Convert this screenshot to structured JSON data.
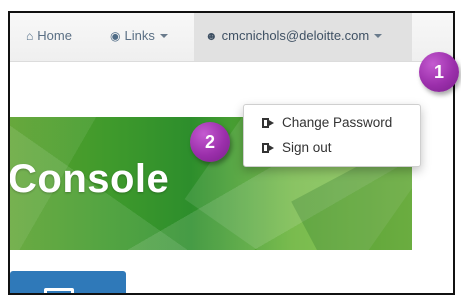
{
  "navbar": {
    "home_label": "Home",
    "links_label": "Links",
    "user_label": "cmcnichols@deloitte.com"
  },
  "icons": {
    "home": "home-icon",
    "links": "globe-icon",
    "user": "user-circle-icon",
    "exit": "sign-out-icon"
  },
  "dropdown": {
    "items": [
      {
        "label": "Change Password"
      },
      {
        "label": "Sign out"
      }
    ]
  },
  "banner": {
    "title": "Console"
  },
  "callouts": {
    "marker_1": "1",
    "marker_2": "2"
  },
  "colors": {
    "accent_green": "#3f9a2c",
    "marker_purple": "#9b2fab",
    "tile_blue": "#2f79b9"
  }
}
